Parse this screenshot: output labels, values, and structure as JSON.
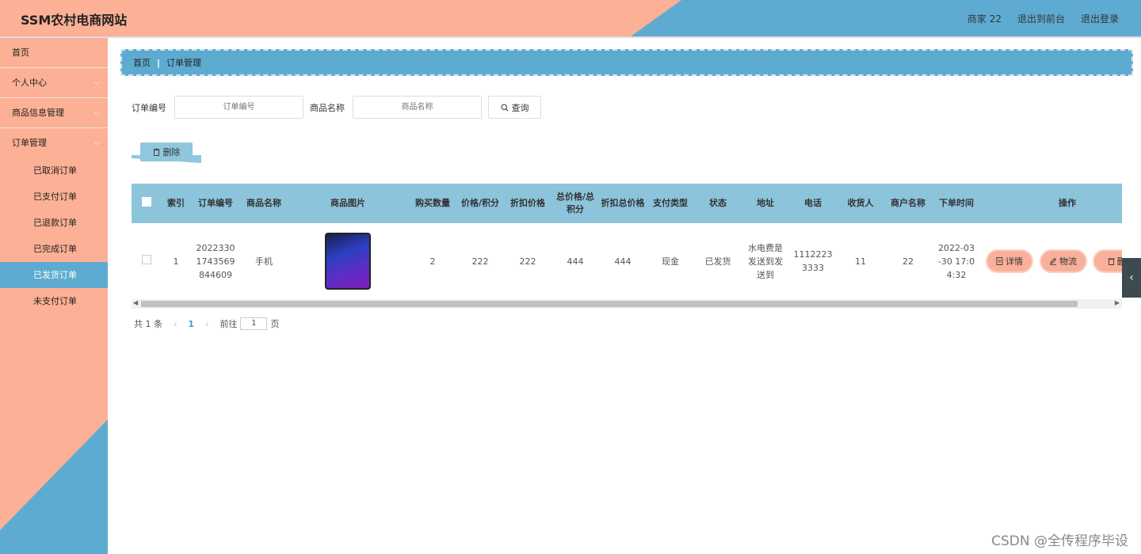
{
  "header": {
    "title": "SSM农村电商网站",
    "user": "商家 22",
    "front_link": "退出到前台",
    "logout": "退出登录"
  },
  "sidebar": {
    "items": [
      {
        "label": "首页"
      },
      {
        "label": "个人中心"
      },
      {
        "label": "商品信息管理"
      },
      {
        "label": "订单管理"
      }
    ],
    "sub_items": [
      {
        "label": "已取消订单"
      },
      {
        "label": "已支付订单"
      },
      {
        "label": "已退款订单"
      },
      {
        "label": "已完成订单"
      },
      {
        "label": "已发货订单"
      },
      {
        "label": "未支付订单"
      }
    ],
    "active": "已发货订单"
  },
  "breadcrumb": {
    "home": "首页",
    "current": "订单管理"
  },
  "search": {
    "order_no_label": "订单编号",
    "order_no_placeholder": "订单编号",
    "product_label": "商品名称",
    "product_placeholder": "商品名称",
    "query_label": "查询"
  },
  "toolbar": {
    "delete_label": "删除"
  },
  "table": {
    "headers": [
      "索引",
      "订单编号",
      "商品名称",
      "商品图片",
      "购买数量",
      "价格/积分",
      "折扣价格",
      "总价格/总积分",
      "折扣总价格",
      "支付类型",
      "状态",
      "地址",
      "电话",
      "收货人",
      "商户名称",
      "下单时间",
      "操作"
    ],
    "rows": [
      {
        "index": "1",
        "order_no": "2022330 1743569 844609",
        "product": "手机",
        "quantity": "2",
        "price": "222",
        "discount_price": "222",
        "total": "444",
        "discount_total": "444",
        "pay_type": "现金",
        "status": "已发货",
        "address": "水电费是 发送到发 送到",
        "phone": "1112223 3333",
        "receiver": "11",
        "merchant": "22",
        "time": "2022-03 -30 17:0 4:32"
      }
    ],
    "actions": {
      "detail": "详情",
      "logistics": "物流",
      "delete": "删"
    }
  },
  "pager": {
    "total": "共 1 条",
    "current": "1",
    "goto_prefix": "前往",
    "goto_value": "1",
    "goto_suffix": "页"
  },
  "watermark": "CSDN @全传程序毕设"
}
